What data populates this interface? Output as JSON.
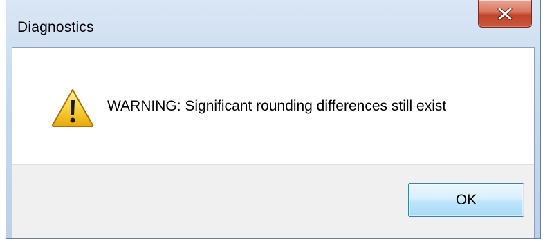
{
  "window": {
    "title": "Diagnostics"
  },
  "titlebar": {
    "close_icon": "close-icon"
  },
  "dialog": {
    "icon": "warning-icon",
    "message": "WARNING: Significant rounding differences still exist"
  },
  "buttons": {
    "ok_label": "OK"
  },
  "colors": {
    "close_button": "#c9583d",
    "warning_fill": "#f5c518",
    "ok_border": "#3c7fb1",
    "footer_bg": "#f0f0f0"
  }
}
